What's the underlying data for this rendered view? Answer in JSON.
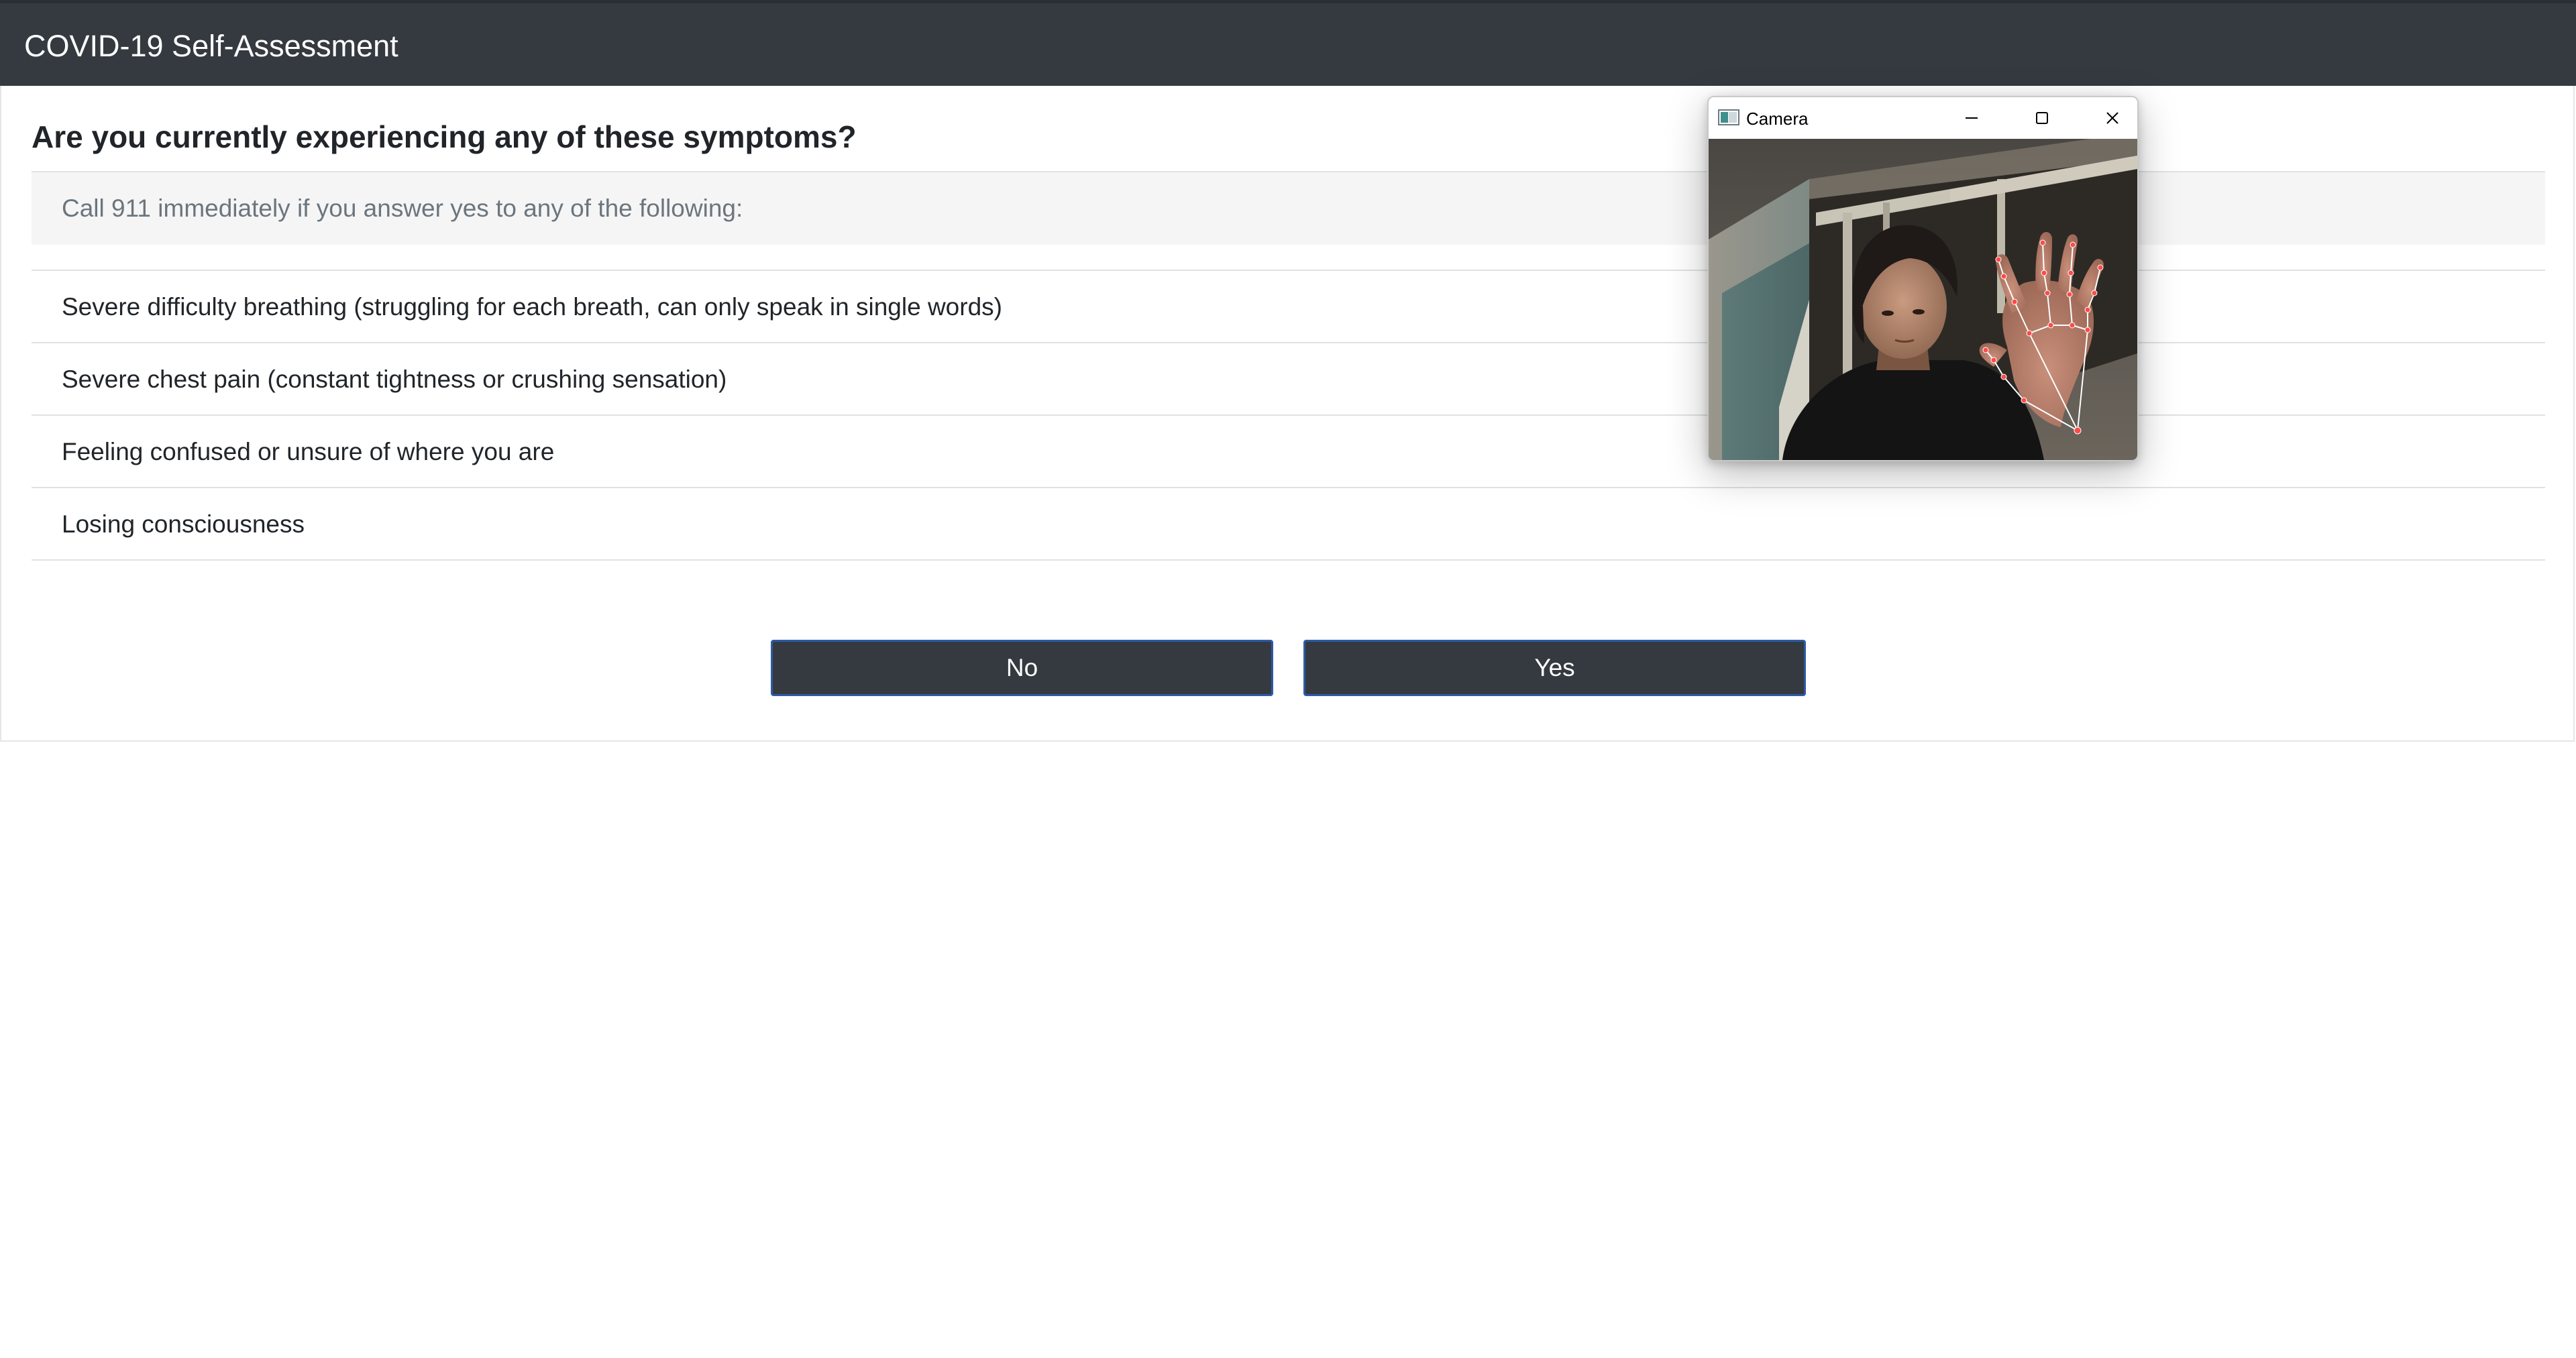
{
  "navbar": {
    "brand": "COVID-19 Self-Assessment"
  },
  "question": {
    "title": "Are you currently experiencing any of these symptoms?",
    "notice": "Call 911 immediately if you answer yes to any of the following:",
    "symptoms": [
      "Severe difficulty breathing (struggling for each breath, can only speak in single words)",
      "Severe chest pain (constant tightness or crushing sensation)",
      "Feeling confused or unsure of where you are",
      "Losing consciousness"
    ]
  },
  "buttons": {
    "no": "No",
    "yes": "Yes"
  },
  "camera_window": {
    "title": "Camera"
  },
  "colors": {
    "navbar": "#343a40",
    "button_bg": "#343a40",
    "button_border": "#2d5aa6",
    "notice_bg": "#f5f5f5",
    "hand_landmarks": "#ff4a4a"
  }
}
